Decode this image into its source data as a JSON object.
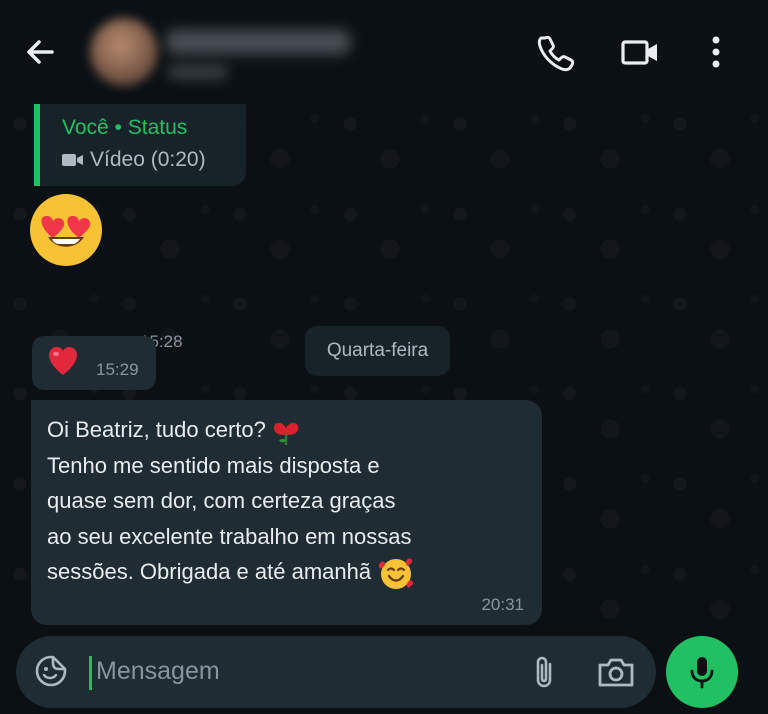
{
  "header": {
    "back_icon": "arrow-left-icon",
    "call_icon": "phone-icon",
    "video_icon": "video-call-icon",
    "more_icon": "more-vertical-icon"
  },
  "status_reply": {
    "title": "Você • Status",
    "subtitle": "Vídeo (0:20)",
    "icon": "video-camera-icon"
  },
  "messages": {
    "emoji_time": "15:28",
    "heart_time": "15:29",
    "date_separator": "Quarta-feira",
    "text_lines": [
      "Oi Beatriz, tudo certo?",
      "Tenho me sentido mais disposta e",
      "quase sem dor, com certeza graças",
      "ao seu excelente trabalho em nossas",
      "sessões. Obrigada e até amanhã"
    ],
    "text_time": "20:31"
  },
  "composer": {
    "placeholder": "Mensagem",
    "sticker_icon": "sticker-icon",
    "attach_icon": "paperclip-icon",
    "camera_icon": "camera-icon",
    "mic_icon": "microphone-icon"
  },
  "colors": {
    "accent": "#21c063",
    "bubble": "#1f2c34",
    "background": "#0b1014"
  }
}
